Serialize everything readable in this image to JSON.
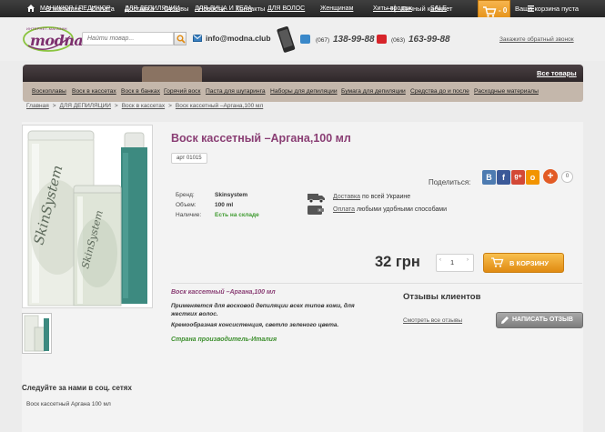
{
  "topbar": {
    "nav": [
      "О магазине",
      "Оплата",
      "Доставка",
      "Отзывы",
      "Новости",
      "Контакты"
    ],
    "account": "Личный кабинет",
    "cart_count": "- 0",
    "cart_status": "Ваша корзина пуста"
  },
  "header": {
    "logo": {
      "word": "modna",
      "tagline": "ИНТЕРНЕТ-МАГАЗИН"
    },
    "search_placeholder": "Найти товар...",
    "email": "info@modna.club",
    "phone1": {
      "code": "(067)",
      "number": "138-99-88"
    },
    "phone2": {
      "code": "(063)",
      "number": "163-99-88"
    },
    "callback": "Закажите обратный звонок"
  },
  "menu": {
    "items": [
      "МАНИКЮР / ПЕДИКЮР",
      "ДЛЯ ДЕПИЛЯЦИИ",
      "ДЛЯ ЛИЦА И ТЕЛА",
      "ДЛЯ ВОЛОС",
      "Женщинам",
      "Хиты продаж",
      "SALE"
    ],
    "all_goods": "Все товары",
    "submenu": [
      "Воскоплавы",
      "Воск в кассетах",
      "Воск в банках",
      "Горячий воск",
      "Паста для шугаринга",
      "Наборы для депиляции",
      "Бумага для депиляции",
      "Средства до и после",
      "Расходные материалы"
    ]
  },
  "breadcrumbs": {
    "items": [
      "Главная",
      "ДЛЯ ДЕПИЛЯЦИИ",
      "Воск в кассетах",
      "Воск кассетный –Аргана,100 мл"
    ],
    "sep": ">"
  },
  "product": {
    "title": "Воск кассетный –Аргана,100 мл",
    "sku": "арт 01015",
    "specs": [
      {
        "key": "Бренд:",
        "value": "Skinsystem"
      },
      {
        "key": "Объем:",
        "value": "100 ml"
      },
      {
        "key": "Наличие:",
        "value": "Есть на складе"
      }
    ],
    "image_brand": "SkinSystem",
    "delivery_link": "Доставка",
    "delivery_text": "по всей Украине",
    "payment_link": "Оплата",
    "payment_text": "любыми удобными способами",
    "share_label": "Поделиться:",
    "share": [
      "B",
      "f",
      "g+",
      "o"
    ],
    "share_plus": "+",
    "share_count": "0",
    "price": "32 грн",
    "qty": "1",
    "qty_minus": "‹",
    "qty_plus": "›",
    "buy_label": "В КОРЗИНУ",
    "description": {
      "title": "Воск кассетный –Аргана,100 мл",
      "p1": "Применяется для восковой депиляции всех типов кожи, для жестких волос.",
      "p2": "Кремообразная консистенция, светло зеленого цвета.",
      "origin": "Страна производитель-Италия"
    }
  },
  "reviews": {
    "title": "Отзывы клиентов",
    "all_link": "Смотреть все отзывы",
    "write_label": "НАПИСАТЬ ОТЗЫВ"
  },
  "footer": {
    "follow": "Следуйте за нами в соц. сетях",
    "tag": "Воск кассетный Аргана 100 мл"
  },
  "colors": {
    "accent_purple": "#8a3e74",
    "cart_orange": "#f2a33a",
    "stock_green": "#3d9a2e"
  }
}
